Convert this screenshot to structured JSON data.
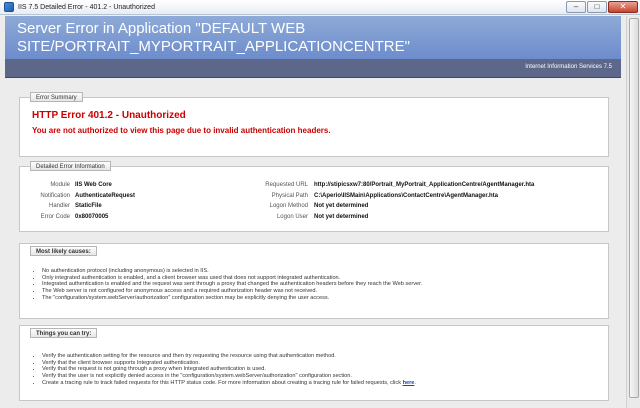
{
  "window": {
    "title": "IIS 7.5 Detailed Error - 401.2 - Unauthorized",
    "minimize": "–",
    "maximize": "□",
    "close": "✕"
  },
  "header": {
    "title_line1": "Server Error in Application \"DEFAULT WEB",
    "title_line2": "SITE/PORTRAIT_MYPORTRAIT_APPLICATIONCENTRE\"",
    "iis_version": "Internet Information Services 7.5"
  },
  "summary": {
    "legend": "Error Summary",
    "error_title": "HTTP Error 401.2 - Unauthorized",
    "error_message": "You are not authorized to view this page due to invalid authentication headers."
  },
  "detail": {
    "legend": "Detailed Error Information",
    "left": [
      {
        "key": "Module",
        "value": "IIS Web Core"
      },
      {
        "key": "Notification",
        "value": "AuthenticateRequest"
      },
      {
        "key": "Handler",
        "value": "StaticFile"
      },
      {
        "key": "Error Code",
        "value": "0x80070005"
      }
    ],
    "right": [
      {
        "key": "Requested URL",
        "value": "http://stipicsxw7:80/Portrait_MyPortrait_ApplicationCentre/AgentManager.hta"
      },
      {
        "key": "Physical Path",
        "value": "C:\\Aperio\\IISMain\\Applications\\ContactCentre\\AgentManager.hta"
      },
      {
        "key": "Logon Method",
        "value": "Not yet determined"
      },
      {
        "key": "Logon User",
        "value": "Not yet determined"
      }
    ]
  },
  "causes": {
    "legend": "Most likely causes:",
    "items": [
      "No authentication protocol (including anonymous) is selected in IIS.",
      "Only integrated authentication is enabled, and a client browser was used that does not support integrated authentication.",
      "Integrated authentication is enabled and the request was sent through a proxy that changed the authentication headers before they reach the Web server.",
      "The Web server is not configured for anonymous access and a required authorization header was not received.",
      "The \"configuration/system.webServer/authorization\" configuration section may be explicitly denying the user access."
    ]
  },
  "actions": {
    "legend": "Things you can try:",
    "items": [
      "Verify the authentication setting for the resource and then try requesting the resource using that authentication method.",
      "Verify that the client browser supports Integrated authentication.",
      "Verify that the request is not going through a proxy when Integrated authentication is used.",
      "Verify that the user is not explicitly denied access in the \"configuration/system.webServer/authorization\" configuration section."
    ],
    "last_item": "Create a tracing rule to track failed requests for this HTTP status code. For more information about creating a tracing rule for failed requests, click",
    "link": "here",
    "after_link": "."
  }
}
